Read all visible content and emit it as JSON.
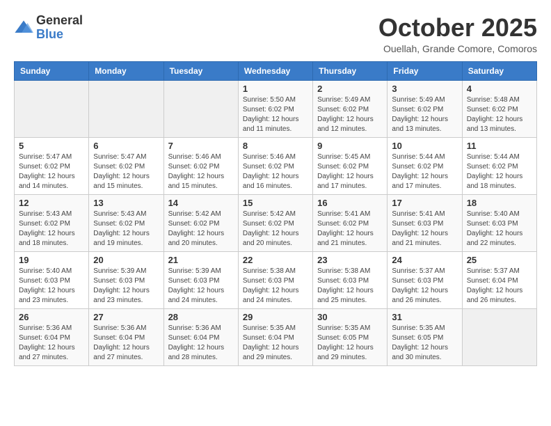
{
  "header": {
    "logo_general": "General",
    "logo_blue": "Blue",
    "month_title": "October 2025",
    "location": "Ouellah, Grande Comore, Comoros"
  },
  "days_of_week": [
    "Sunday",
    "Monday",
    "Tuesday",
    "Wednesday",
    "Thursday",
    "Friday",
    "Saturday"
  ],
  "weeks": [
    [
      {
        "day": "",
        "info": ""
      },
      {
        "day": "",
        "info": ""
      },
      {
        "day": "",
        "info": ""
      },
      {
        "day": "1",
        "info": "Sunrise: 5:50 AM\nSunset: 6:02 PM\nDaylight: 12 hours\nand 11 minutes."
      },
      {
        "day": "2",
        "info": "Sunrise: 5:49 AM\nSunset: 6:02 PM\nDaylight: 12 hours\nand 12 minutes."
      },
      {
        "day": "3",
        "info": "Sunrise: 5:49 AM\nSunset: 6:02 PM\nDaylight: 12 hours\nand 13 minutes."
      },
      {
        "day": "4",
        "info": "Sunrise: 5:48 AM\nSunset: 6:02 PM\nDaylight: 12 hours\nand 13 minutes."
      }
    ],
    [
      {
        "day": "5",
        "info": "Sunrise: 5:47 AM\nSunset: 6:02 PM\nDaylight: 12 hours\nand 14 minutes."
      },
      {
        "day": "6",
        "info": "Sunrise: 5:47 AM\nSunset: 6:02 PM\nDaylight: 12 hours\nand 15 minutes."
      },
      {
        "day": "7",
        "info": "Sunrise: 5:46 AM\nSunset: 6:02 PM\nDaylight: 12 hours\nand 15 minutes."
      },
      {
        "day": "8",
        "info": "Sunrise: 5:46 AM\nSunset: 6:02 PM\nDaylight: 12 hours\nand 16 minutes."
      },
      {
        "day": "9",
        "info": "Sunrise: 5:45 AM\nSunset: 6:02 PM\nDaylight: 12 hours\nand 17 minutes."
      },
      {
        "day": "10",
        "info": "Sunrise: 5:44 AM\nSunset: 6:02 PM\nDaylight: 12 hours\nand 17 minutes."
      },
      {
        "day": "11",
        "info": "Sunrise: 5:44 AM\nSunset: 6:02 PM\nDaylight: 12 hours\nand 18 minutes."
      }
    ],
    [
      {
        "day": "12",
        "info": "Sunrise: 5:43 AM\nSunset: 6:02 PM\nDaylight: 12 hours\nand 18 minutes."
      },
      {
        "day": "13",
        "info": "Sunrise: 5:43 AM\nSunset: 6:02 PM\nDaylight: 12 hours\nand 19 minutes."
      },
      {
        "day": "14",
        "info": "Sunrise: 5:42 AM\nSunset: 6:02 PM\nDaylight: 12 hours\nand 20 minutes."
      },
      {
        "day": "15",
        "info": "Sunrise: 5:42 AM\nSunset: 6:02 PM\nDaylight: 12 hours\nand 20 minutes."
      },
      {
        "day": "16",
        "info": "Sunrise: 5:41 AM\nSunset: 6:02 PM\nDaylight: 12 hours\nand 21 minutes."
      },
      {
        "day": "17",
        "info": "Sunrise: 5:41 AM\nSunset: 6:03 PM\nDaylight: 12 hours\nand 21 minutes."
      },
      {
        "day": "18",
        "info": "Sunrise: 5:40 AM\nSunset: 6:03 PM\nDaylight: 12 hours\nand 22 minutes."
      }
    ],
    [
      {
        "day": "19",
        "info": "Sunrise: 5:40 AM\nSunset: 6:03 PM\nDaylight: 12 hours\nand 23 minutes."
      },
      {
        "day": "20",
        "info": "Sunrise: 5:39 AM\nSunset: 6:03 PM\nDaylight: 12 hours\nand 23 minutes."
      },
      {
        "day": "21",
        "info": "Sunrise: 5:39 AM\nSunset: 6:03 PM\nDaylight: 12 hours\nand 24 minutes."
      },
      {
        "day": "22",
        "info": "Sunrise: 5:38 AM\nSunset: 6:03 PM\nDaylight: 12 hours\nand 24 minutes."
      },
      {
        "day": "23",
        "info": "Sunrise: 5:38 AM\nSunset: 6:03 PM\nDaylight: 12 hours\nand 25 minutes."
      },
      {
        "day": "24",
        "info": "Sunrise: 5:37 AM\nSunset: 6:03 PM\nDaylight: 12 hours\nand 26 minutes."
      },
      {
        "day": "25",
        "info": "Sunrise: 5:37 AM\nSunset: 6:04 PM\nDaylight: 12 hours\nand 26 minutes."
      }
    ],
    [
      {
        "day": "26",
        "info": "Sunrise: 5:36 AM\nSunset: 6:04 PM\nDaylight: 12 hours\nand 27 minutes."
      },
      {
        "day": "27",
        "info": "Sunrise: 5:36 AM\nSunset: 6:04 PM\nDaylight: 12 hours\nand 27 minutes."
      },
      {
        "day": "28",
        "info": "Sunrise: 5:36 AM\nSunset: 6:04 PM\nDaylight: 12 hours\nand 28 minutes."
      },
      {
        "day": "29",
        "info": "Sunrise: 5:35 AM\nSunset: 6:04 PM\nDaylight: 12 hours\nand 29 minutes."
      },
      {
        "day": "30",
        "info": "Sunrise: 5:35 AM\nSunset: 6:05 PM\nDaylight: 12 hours\nand 29 minutes."
      },
      {
        "day": "31",
        "info": "Sunrise: 5:35 AM\nSunset: 6:05 PM\nDaylight: 12 hours\nand 30 minutes."
      },
      {
        "day": "",
        "info": ""
      }
    ]
  ]
}
